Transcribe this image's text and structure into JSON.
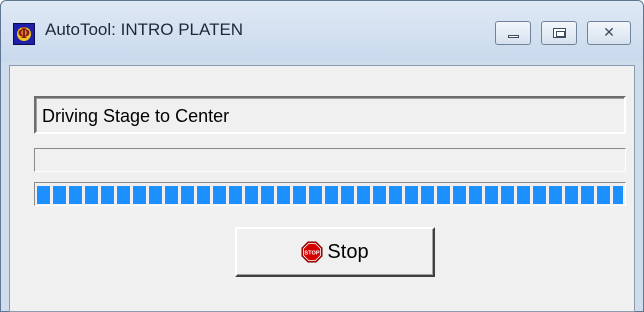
{
  "window": {
    "title": "AutoTool: INTRO PLATEN",
    "app_icon_glyph": "Φ",
    "app_icon": "phi-icon",
    "controls": {
      "minimize": "minimize-icon",
      "maximize": "maximize-icon",
      "close": "close-icon",
      "close_glyph": "✕"
    }
  },
  "status": {
    "message": "Driving Stage to Center",
    "secondary": ""
  },
  "progress": {
    "value_percent": 100,
    "color": "#1e8fff"
  },
  "stop_button": {
    "label": "Stop",
    "icon": "stop-sign-icon",
    "icon_text": "STOP",
    "icon_color": "#d40000"
  }
}
